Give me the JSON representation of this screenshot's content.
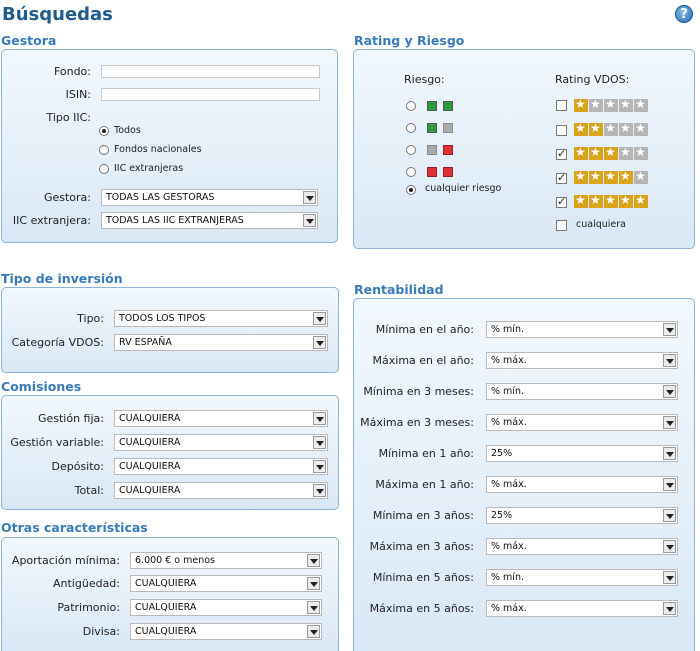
{
  "page": {
    "title": "Búsquedas",
    "help": "?"
  },
  "gestora": {
    "title": "Gestora",
    "fondo_label": "Fondo:",
    "isin_label": "ISIN:",
    "tipo_label": "Tipo IIC:",
    "tipo_options": [
      "Todos",
      "Fondos nacionales",
      "IIC extranjeras"
    ],
    "tipo_selected": 0,
    "gestora_label": "Gestora:",
    "gestora_value": "TODAS LAS GESTORAS",
    "iic_label": "IIC extranjera:",
    "iic_value": "TODAS LAS IIC EXTRANJERAS"
  },
  "rating": {
    "title": "Rating y Riesgo",
    "riesgo_label": "Riesgo:",
    "rating_label": "Rating VDOS:",
    "riesgo_options": [
      {
        "squares": [
          "green",
          "green"
        ]
      },
      {
        "squares": [
          "green",
          "grey"
        ]
      },
      {
        "squares": [
          "grey",
          "red"
        ]
      },
      {
        "squares": [
          "red",
          "red"
        ]
      },
      {
        "label": "cualquier riesgo"
      }
    ],
    "riesgo_selected": 4,
    "rating_options": [
      {
        "stars": 1,
        "checked": false
      },
      {
        "stars": 2,
        "checked": false
      },
      {
        "stars": 3,
        "checked": true
      },
      {
        "stars": 4,
        "checked": true
      },
      {
        "stars": 5,
        "checked": true
      }
    ],
    "cualquiera_label": "cualquiera",
    "cualquiera_checked": false
  },
  "tipo_inversion": {
    "title": "Tipo de inversión",
    "tipo_label": "Tipo:",
    "tipo_value": "TODOS LOS TIPOS",
    "categoria_label": "Categoría VDOS:",
    "categoria_value": "RV ESPAÑA"
  },
  "comisiones": {
    "title": "Comisiones",
    "rows": [
      {
        "label": "Gestión fija:",
        "value": "CUALQUIERA"
      },
      {
        "label": "Gestión variable:",
        "value": "CUALQUIERA"
      },
      {
        "label": "Depósito:",
        "value": "CUALQUIERA"
      },
      {
        "label": "Total:",
        "value": "CUALQUIERA"
      }
    ]
  },
  "otras": {
    "title": "Otras características",
    "rows": [
      {
        "label": "Aportación mínima:",
        "value": "6.000 € o menos"
      },
      {
        "label": "Antigüedad:",
        "value": "CUALQUIERA"
      },
      {
        "label": "Patrimonio:",
        "value": "CUALQUIERA"
      },
      {
        "label": "Divisa:",
        "value": "CUALQUIERA"
      }
    ]
  },
  "rentabilidad": {
    "title": "Rentabilidad",
    "rows": [
      {
        "label": "Mínima en el año:",
        "value": "% mín."
      },
      {
        "label": "Máxima en el año:",
        "value": "% máx."
      },
      {
        "label": "Mínima en 3 meses:",
        "value": "% mín."
      },
      {
        "label": "Máxima en 3 meses:",
        "value": "% máx."
      },
      {
        "label": "Mínima en 1 año:",
        "value": "25%"
      },
      {
        "label": "Máxima en 1 año:",
        "value": "% máx."
      },
      {
        "label": "Mínima en 3 años:",
        "value": "25%"
      },
      {
        "label": "Máxima en 3 años:",
        "value": "% máx."
      },
      {
        "label": "Mínima en 5 años:",
        "value": "% mín."
      },
      {
        "label": "Máxima en 5 años:",
        "value": "% máx."
      }
    ]
  }
}
